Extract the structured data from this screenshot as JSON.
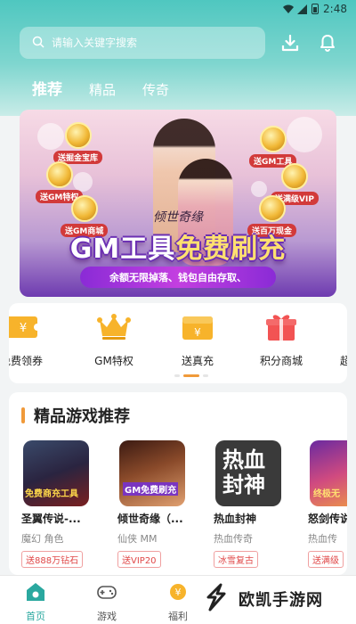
{
  "status_bar": {
    "time": "2:48"
  },
  "search": {
    "placeholder": "请输入关键字搜索"
  },
  "tabs": [
    {
      "label": "推荐",
      "active": true
    },
    {
      "label": "精品",
      "active": false
    },
    {
      "label": "传奇",
      "active": false
    }
  ],
  "banner": {
    "game_title": "倾世奇缘",
    "headline_part1": "GM工具",
    "headline_part2": "免费刷充",
    "subline": "余额无限掉落、钱包自由存取、",
    "badges": [
      "送掘金宝库",
      "送GM特权",
      "送GM商城",
      "送GM工具",
      "送满级VIP",
      "送百万现金"
    ]
  },
  "quick_actions": [
    {
      "label": "免费领券",
      "icon": "coupon-icon"
    },
    {
      "label": "GM特权",
      "icon": "crown-icon"
    },
    {
      "label": "送真充",
      "icon": "wallet-icon"
    },
    {
      "label": "积分商城",
      "icon": "gift-icon"
    },
    {
      "label": "超",
      "icon": "more-icon"
    }
  ],
  "section": {
    "title": "精品游戏推荐",
    "games": [
      {
        "name": "圣翼传说-...",
        "meta": "魔幻 角色",
        "tag": "送888万钻石",
        "cover_text": "免费商充工具"
      },
      {
        "name": "倾世奇缘（...",
        "meta": "仙侠 MM",
        "tag": "送VIP20",
        "cover_text": "GM免费刷充"
      },
      {
        "name": "热血封神",
        "meta": "热血传奇",
        "tag": "冰雪复古",
        "cover_text": "热血封神"
      },
      {
        "name": "怒剑传说",
        "meta": "热血传",
        "tag": "送满级",
        "cover_text": "终极无"
      }
    ]
  },
  "bottom_nav": [
    {
      "label": "首页",
      "icon": "home-icon",
      "active": true
    },
    {
      "label": "游戏",
      "icon": "gamepad-icon",
      "active": false
    },
    {
      "label": "福利",
      "icon": "coin-icon",
      "active": false
    }
  ],
  "watermark": {
    "text": "欧凯手游网"
  },
  "colors": {
    "accent": "#2aa89f",
    "orange": "#f09a3a",
    "tag_red": "#e04848"
  }
}
